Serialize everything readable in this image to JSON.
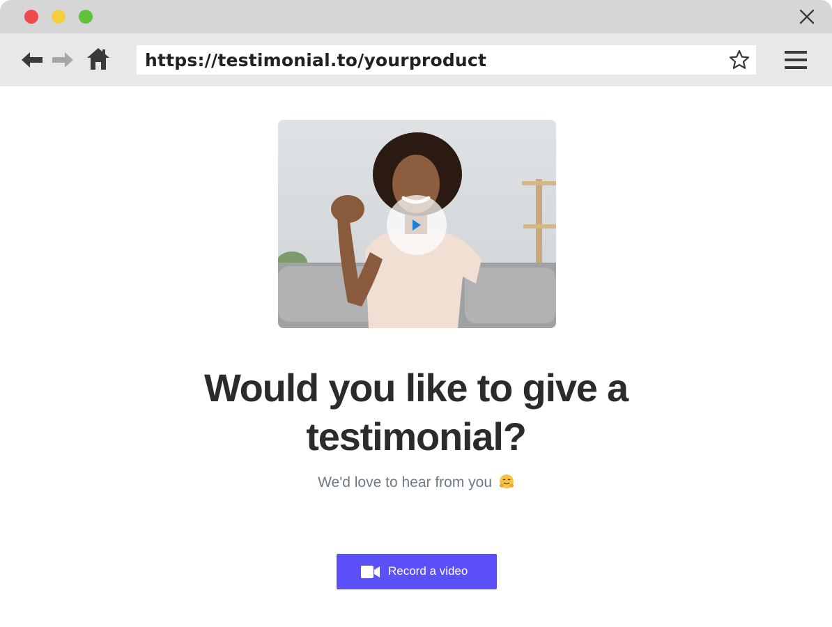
{
  "browser": {
    "url": "https://testimonial.to/yourproduct",
    "colors": {
      "close": "#f14a4a",
      "minimize": "#f7cf3c",
      "zoom": "#5fc23a"
    },
    "icons": [
      "back-arrow-icon",
      "forward-arrow-icon",
      "home-icon",
      "star-icon",
      "hamburger-menu-icon",
      "close-icon"
    ]
  },
  "main": {
    "headline": "Would you like to give a testimonial?",
    "subtitle": "We'd love to hear from you",
    "subtitle_emoji": "hugging-face-emoji",
    "video": {
      "icon": "play-icon",
      "accent": "#1e7fd6"
    },
    "record_button": {
      "label": "Record a video",
      "icon": "video-camera-icon",
      "color": "#5b4ff7"
    }
  }
}
